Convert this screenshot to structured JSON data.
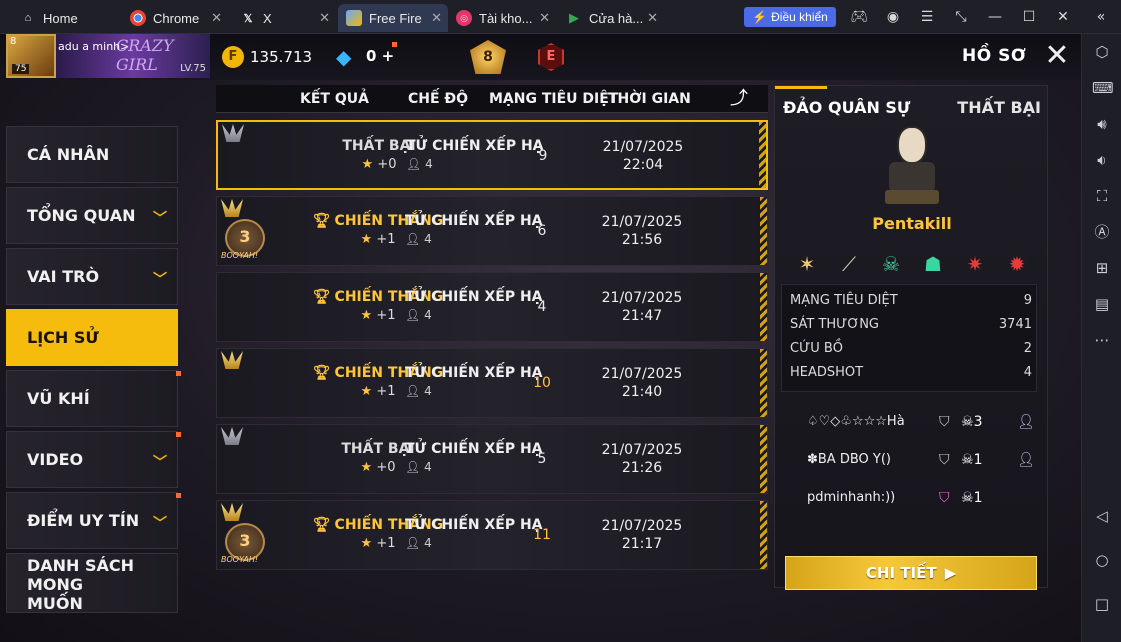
{
  "browser": {
    "tabs": [
      {
        "label": "Home",
        "icon": "home-icon"
      },
      {
        "label": "Chrome",
        "icon": "chrome-icon"
      },
      {
        "label": "X",
        "icon": "x-logo-icon"
      },
      {
        "label": "Free Fire",
        "icon": "free-fire-icon"
      },
      {
        "label": "Tài kho...",
        "icon": "account-app-icon"
      },
      {
        "label": "Cửa hà...",
        "icon": "play-store-icon"
      }
    ],
    "control_button": "Điều khiển"
  },
  "player": {
    "name": "adu a minh>",
    "level_badge": "75",
    "level_text": "LV.75",
    "avatar_rank": "8"
  },
  "currency": {
    "coins": "135.713",
    "diamonds": "0",
    "diamond_plus": "+"
  },
  "ranks": {
    "br_rank": "8",
    "cs_rank": "E"
  },
  "header": {
    "title": "HỒ SƠ"
  },
  "nav": {
    "items": [
      {
        "label": "CÁ NHÂN"
      },
      {
        "label": "TỔNG QUAN"
      },
      {
        "label": "VAI TRÒ"
      },
      {
        "label": "LỊCH SỬ"
      },
      {
        "label": "VŨ KHÍ"
      },
      {
        "label": "VIDEO"
      },
      {
        "label": "ĐIỂM UY TÍN"
      },
      {
        "label": "DANH SÁCH MONG MUỐN"
      }
    ]
  },
  "table": {
    "headers": [
      "KẾT QUẢ",
      "CHẾ ĐỘ",
      "MẠNG TIÊU DIỆT",
      "THỜI GIAN"
    ],
    "rows": [
      {
        "result": "THẤT BẠI",
        "points": "+0",
        "mode": "TỬ CHIẾN XẾP HẠ",
        "players": "4",
        "kills": "9",
        "date": "21/07/2025",
        "time": "22:04"
      },
      {
        "result": "CHIẾN THẮNG",
        "points": "+1",
        "mode": "TỬ CHIẾN XẾP HẠ",
        "players": "4",
        "kills": "6",
        "date": "21/07/2025",
        "time": "21:56"
      },
      {
        "result": "CHIẾN THẮNG",
        "points": "+1",
        "mode": "TỬ CHIẾN XẾP HẠ",
        "players": "4",
        "kills": "4",
        "date": "21/07/2025",
        "time": "21:47"
      },
      {
        "result": "CHIẾN THẮNG",
        "points": "+1",
        "mode": "TỬ CHIẾN XẾP HẠ",
        "players": "4",
        "kills": "10",
        "date": "21/07/2025",
        "time": "21:40"
      },
      {
        "result": "THẤT BẠI",
        "points": "+0",
        "mode": "TỬ CHIẾN XẾP HẠ",
        "players": "4",
        "kills": "5",
        "date": "21/07/2025",
        "time": "21:26"
      },
      {
        "result": "CHIẾN THẮNG",
        "points": "+1",
        "mode": "TỬ CHIẾN XẾP HẠ",
        "players": "4",
        "kills": "11",
        "date": "21/07/2025",
        "time": "21:17"
      }
    ],
    "medal_number": "3",
    "medal_tag": "BOOYAH!"
  },
  "detail": {
    "map": "ĐẢO QUÂN SỰ",
    "result": "THẤT BẠI",
    "title": "Pentakill",
    "stats": [
      {
        "label": "MẠNG TIÊU DIỆT",
        "value": "9"
      },
      {
        "label": "SÁT THƯƠNG",
        "value": "3741"
      },
      {
        "label": "CỨU BỒ",
        "value": "2"
      },
      {
        "label": "HEADSHOT",
        "value": "4"
      }
    ],
    "players": [
      {
        "name": "♤♡◇♧☆☆☆Hà",
        "kills": "3"
      },
      {
        "name": "✽BA DBO Y()",
        "kills": "1"
      },
      {
        "name": "pdminhanh:))",
        "kills": "1"
      }
    ],
    "button": "CHI TIẾT"
  }
}
